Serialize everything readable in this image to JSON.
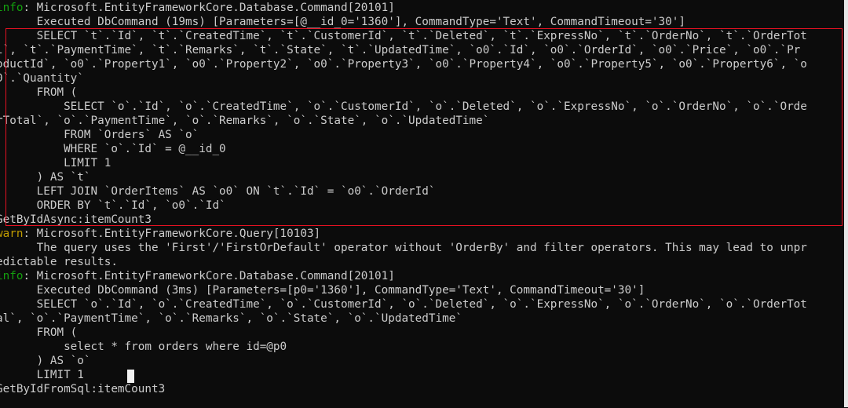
{
  "colors": {
    "background": "#0c0c0c",
    "text": "#cccccc",
    "info": "#13a10e",
    "warn": "#c19c00",
    "highlight": "#e81123"
  },
  "lines": [
    {
      "level": "info",
      "prefix": "info",
      "text": ": Microsoft.EntityFrameworkCore.Database.Command[20101]"
    },
    {
      "text": "      Executed DbCommand (19ms) [Parameters=[@__id_0='1360'], CommandType='Text', CommandTimeout='30']"
    },
    {
      "text": "      SELECT `t`.`Id`, `t`.`CreatedTime`, `t`.`CustomerId`, `t`.`Deleted`, `t`.`ExpressNo`, `t`.`OrderNo`, `t`.`OrderTot"
    },
    {
      "text": "l`, `t`.`PaymentTime`, `t`.`Remarks`, `t`.`State`, `t`.`UpdatedTime`, `o0`.`Id`, `o0`.`OrderId`, `o0`.`Price`, `o0`.`Pr"
    },
    {
      "text": "oductId`, `o0`.`Property1`, `o0`.`Property2`, `o0`.`Property3`, `o0`.`Property4`, `o0`.`Property5`, `o0`.`Property6`, `o"
    },
    {
      "text": "0`.`Quantity`"
    },
    {
      "text": "      FROM ("
    },
    {
      "text": "          SELECT `o`.`Id`, `o`.`CreatedTime`, `o`.`CustomerId`, `o`.`Deleted`, `o`.`ExpressNo`, `o`.`OrderNo`, `o`.`Orde"
    },
    {
      "text": "rTotal`, `o`.`PaymentTime`, `o`.`Remarks`, `o`.`State`, `o`.`UpdatedTime`"
    },
    {
      "text": "          FROM `Orders` AS `o`"
    },
    {
      "text": "          WHERE `o`.`Id` = @__id_0"
    },
    {
      "text": "          LIMIT 1"
    },
    {
      "text": "      ) AS `t`"
    },
    {
      "text": "      LEFT JOIN `OrderItems` AS `o0` ON `t`.`Id` = `o0`.`OrderId`"
    },
    {
      "text": "      ORDER BY `t`.`Id`, `o0`.`Id`"
    },
    {
      "text": "GetByIdAsync:itemCount3"
    },
    {
      "level": "warn",
      "prefix": "warn",
      "text": ": Microsoft.EntityFrameworkCore.Query[10103]"
    },
    {
      "text": "      The query uses the 'First'/'FirstOrDefault' operator without 'OrderBy' and filter operators. This may lead to unpr"
    },
    {
      "text": "edictable results."
    },
    {
      "level": "info",
      "prefix": "info",
      "text": ": Microsoft.EntityFrameworkCore.Database.Command[20101]"
    },
    {
      "text": "      Executed DbCommand (3ms) [Parameters=[p0='1360'], CommandType='Text', CommandTimeout='30']"
    },
    {
      "text": "      SELECT `o`.`Id`, `o`.`CreatedTime`, `o`.`CustomerId`, `o`.`Deleted`, `o`.`ExpressNo`, `o`.`OrderNo`, `o`.`OrderTot"
    },
    {
      "text": "al`, `o`.`PaymentTime`, `o`.`Remarks`, `o`.`State`, `o`.`UpdatedTime`"
    },
    {
      "text": "      FROM ("
    },
    {
      "text": "          select * from orders where id=@p0"
    },
    {
      "text": "      ) AS `o`"
    },
    {
      "text": "      LIMIT 1"
    },
    {
      "text": "GetByIdFromSql:itemCount3"
    }
  ]
}
